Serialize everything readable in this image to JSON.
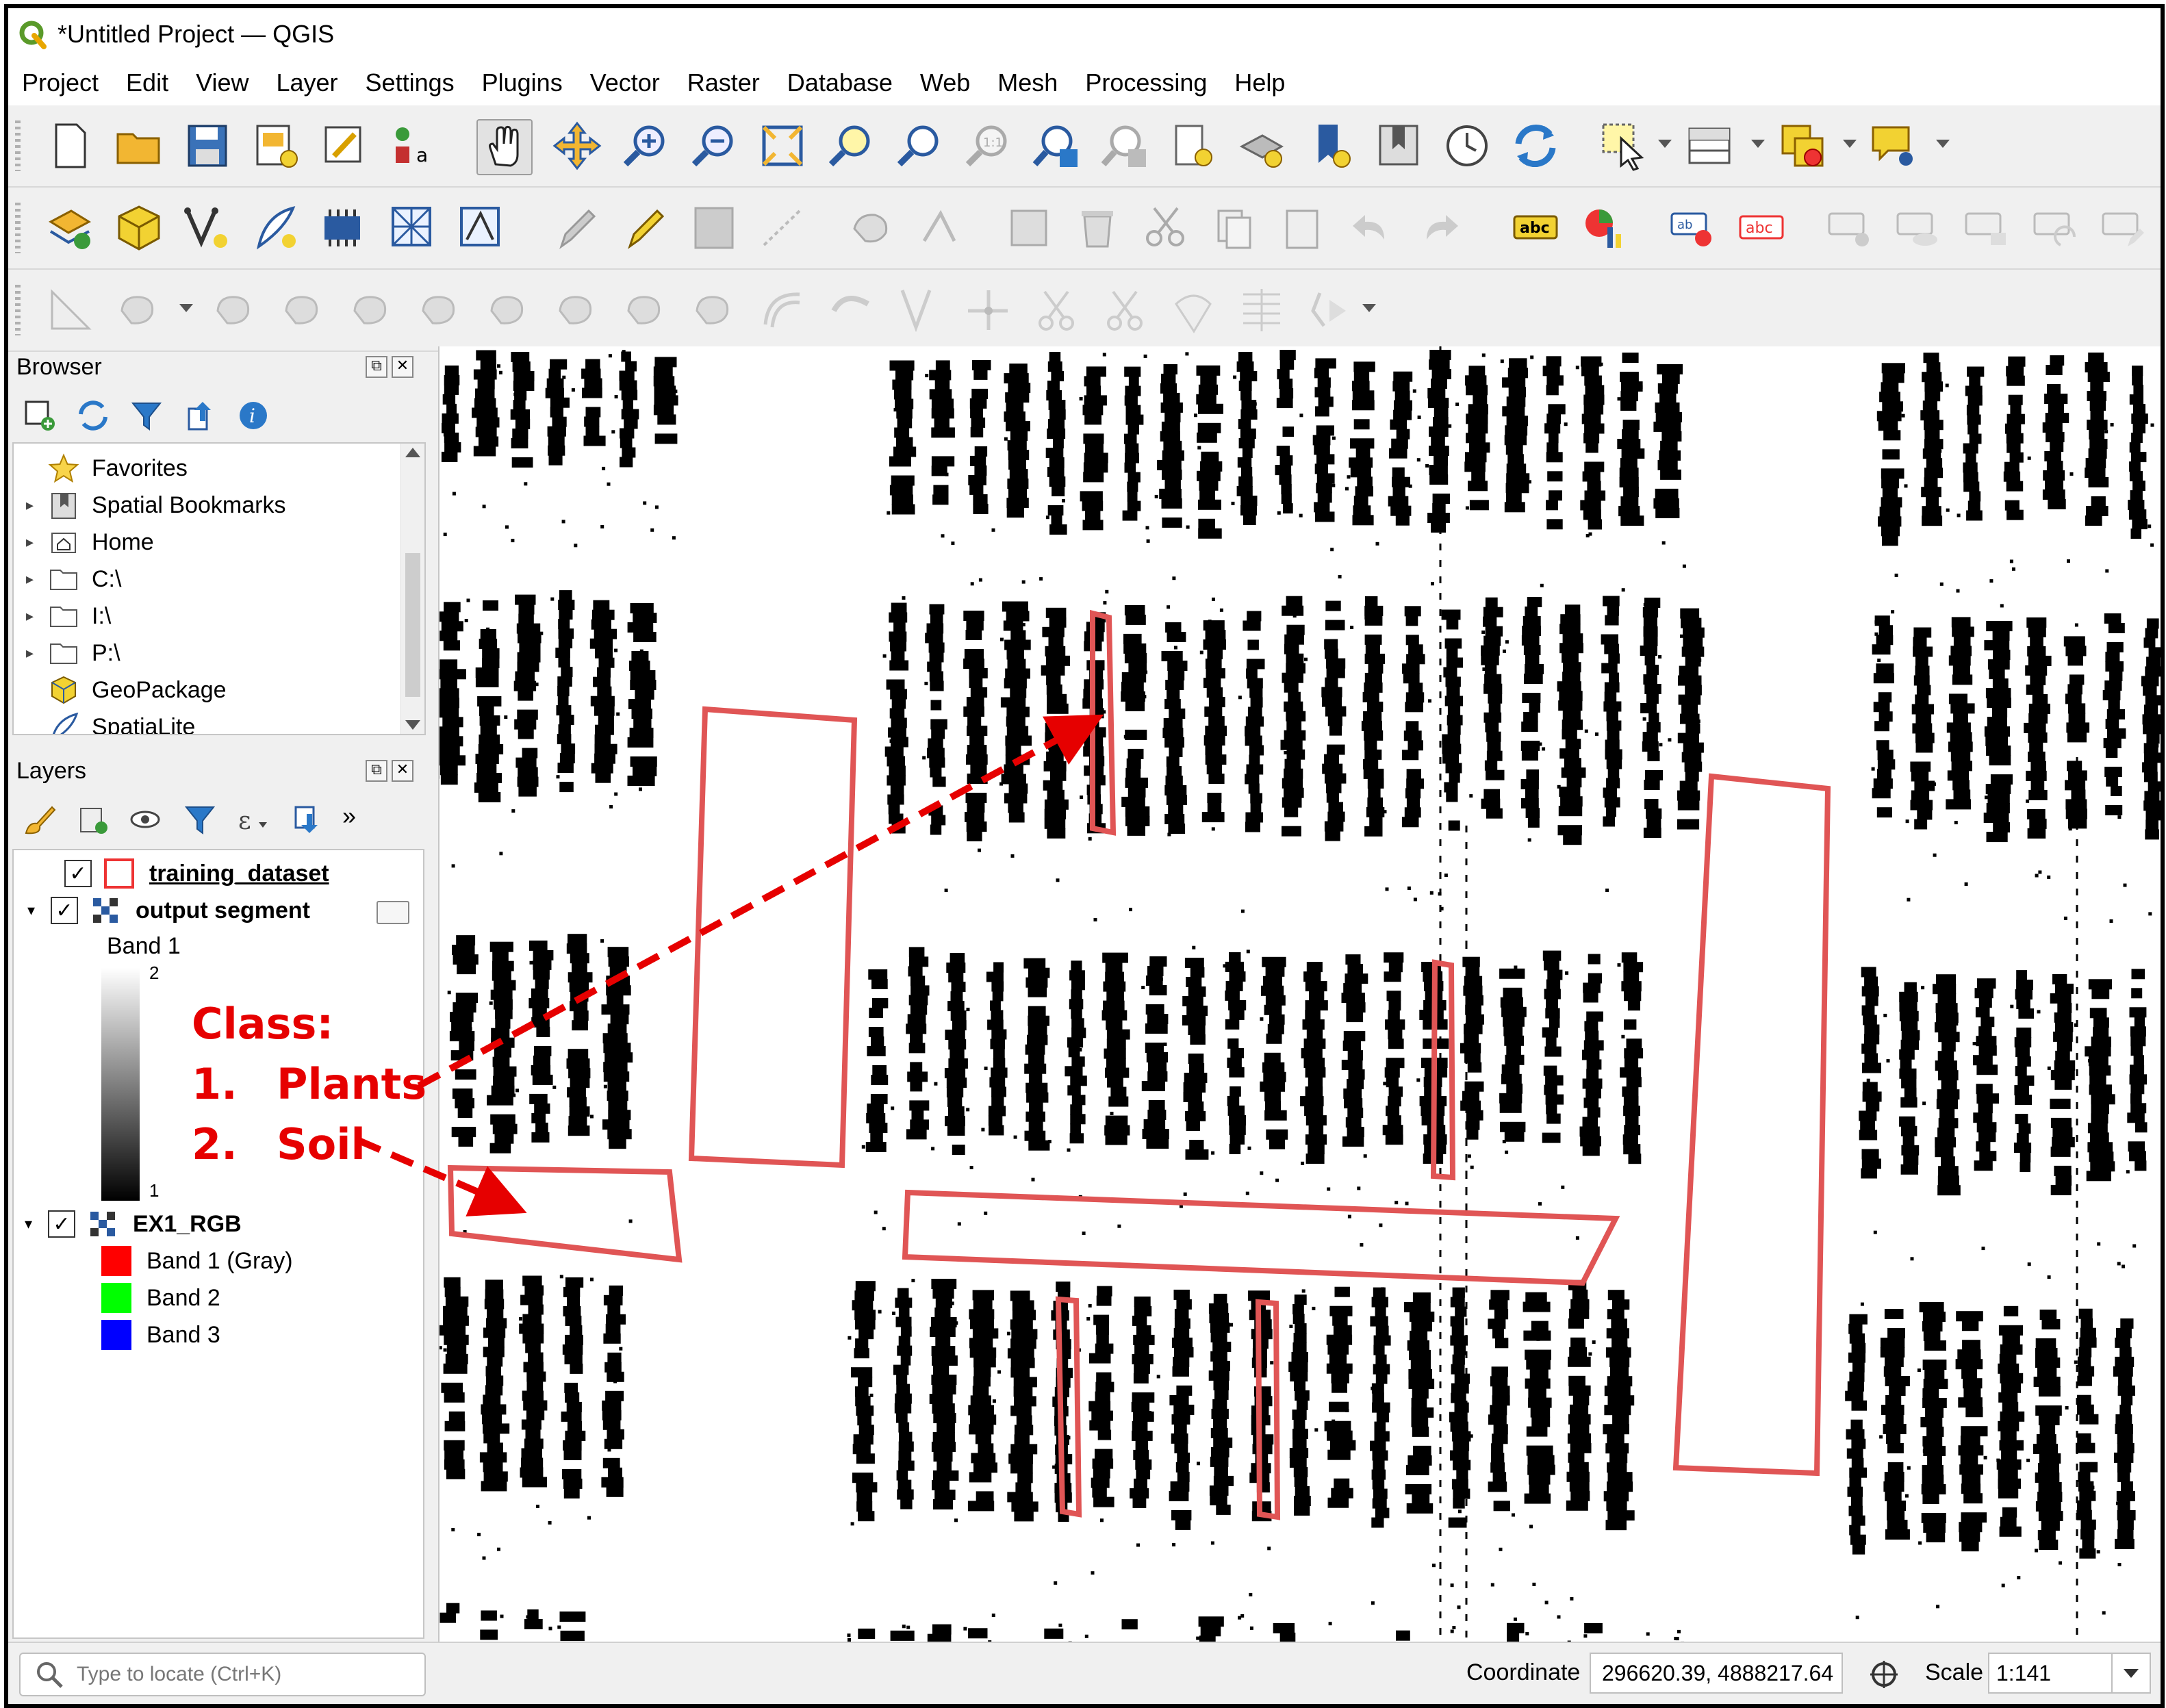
{
  "window": {
    "title": "*Untitled Project — QGIS"
  },
  "menubar": [
    "Project",
    "Edit",
    "View",
    "Layer",
    "Settings",
    "Plugins",
    "Vector",
    "Raster",
    "Database",
    "Web",
    "Mesh",
    "Processing",
    "Help"
  ],
  "browser": {
    "title": "Browser",
    "items": [
      {
        "label": "Favorites",
        "icon": "star-icon",
        "expandable": false
      },
      {
        "label": "Spatial Bookmarks",
        "icon": "bookmark-icon",
        "expandable": true
      },
      {
        "label": "Home",
        "icon": "home-folder-icon",
        "expandable": true
      },
      {
        "label": "C:\\",
        "icon": "folder-icon",
        "expandable": true
      },
      {
        "label": "I:\\",
        "icon": "folder-icon",
        "expandable": true
      },
      {
        "label": "P:\\",
        "icon": "folder-icon",
        "expandable": true
      },
      {
        "label": "GeoPackage",
        "icon": "geopackage-icon",
        "expandable": false
      },
      {
        "label": "SpatiaLite",
        "icon": "spatialite-icon",
        "expandable": false
      }
    ]
  },
  "layers": {
    "title": "Layers",
    "training_dataset": {
      "name": "training_dataset",
      "checked": true
    },
    "output_segment": {
      "name": "output segment",
      "checked": true,
      "band": "Band 1",
      "ramp_max": "2",
      "ramp_min": "1"
    },
    "ex1_rgb": {
      "name": "EX1_RGB",
      "checked": true,
      "bands": [
        {
          "label": "Band 1 (Gray)",
          "color": "#ff0000"
        },
        {
          "label": "Band 2",
          "color": "#00ff00"
        },
        {
          "label": "Band 3",
          "color": "#0000ff"
        }
      ]
    }
  },
  "annotation": {
    "heading": "Class:",
    "items": [
      {
        "num": "1.",
        "label": "Plants"
      },
      {
        "num": "2.",
        "label": "Soil"
      }
    ],
    "color": "#e60000"
  },
  "statusbar": {
    "locator_placeholder": "Type to locate (Ctrl+K)",
    "coordinate_label": "Coordinate",
    "coordinate_value": "296620.39, 4888217.64",
    "scale_label": "Scale",
    "scale_value": "1:141"
  },
  "colors": {
    "polygon_outline": "#e05555",
    "plant_fill": "#000000",
    "accent_red": "#e60000"
  }
}
